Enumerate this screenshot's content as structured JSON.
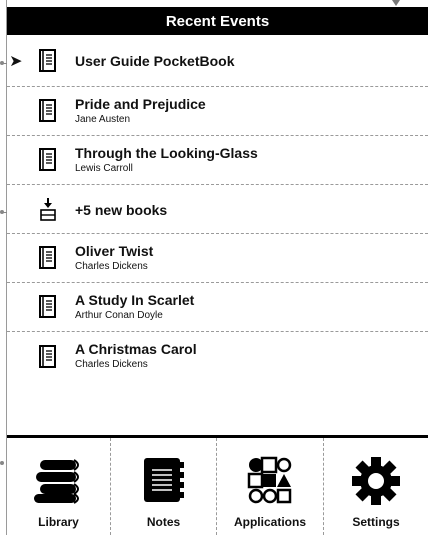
{
  "header": {
    "title": "Recent Events"
  },
  "items": [
    {
      "title": "User  Guide  PocketBook",
      "subtitle": "",
      "icon": "book-icon",
      "current": true
    },
    {
      "title": "Pride and Prejudice",
      "subtitle": "Jane Austen",
      "icon": "book-icon"
    },
    {
      "title": "Through the Looking-Glass",
      "subtitle": "Lewis Carroll",
      "icon": "book-icon"
    },
    {
      "title": "+5 new books",
      "subtitle": "",
      "icon": "download-icon"
    },
    {
      "title": "Oliver Twist",
      "subtitle": "Charles Dickens",
      "icon": "book-icon"
    },
    {
      "title": "A Study In Scarlet",
      "subtitle": "Arthur Conan Doyle",
      "icon": "book-icon"
    },
    {
      "title": "A Christmas Carol",
      "subtitle": "Charles Dickens",
      "icon": "book-icon"
    }
  ],
  "bottom_nav": [
    {
      "label": "Library",
      "icon": "library-icon"
    },
    {
      "label": "Notes",
      "icon": "notes-icon"
    },
    {
      "label": "Applications",
      "icon": "applications-icon"
    },
    {
      "label": "Settings",
      "icon": "settings-gear-icon"
    }
  ]
}
